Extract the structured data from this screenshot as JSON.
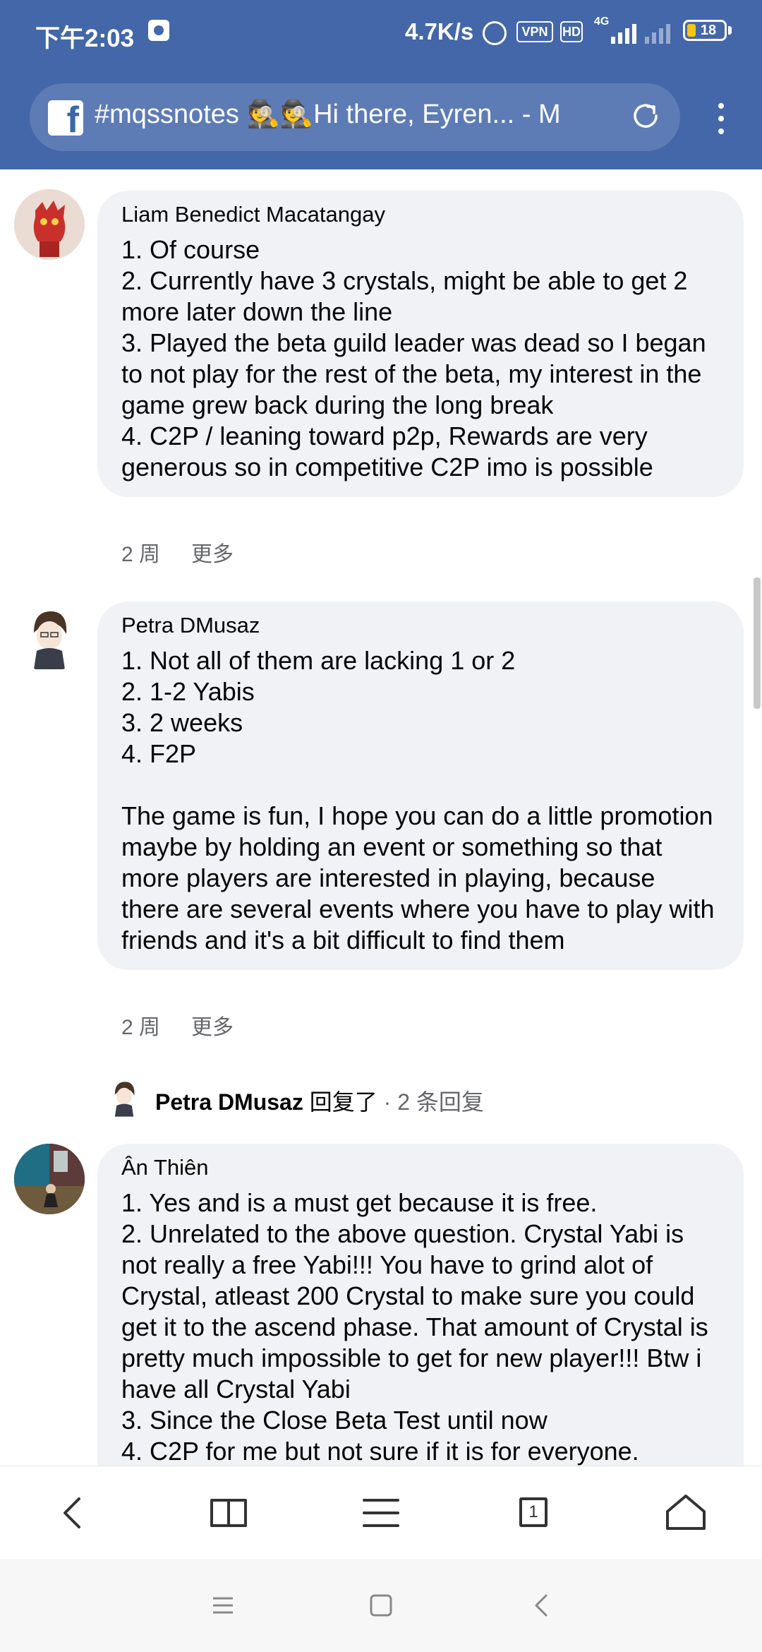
{
  "status_bar": {
    "time": "下午2:03",
    "net_speed": "4.7K/s",
    "vpn_label": "VPN",
    "hd_label": "HD",
    "network_label": "4G",
    "battery_level": "18"
  },
  "browser": {
    "tab_title": "#mqssnotes 🕵️🕵️Hi there, Eyren... - M",
    "favicon": "facebook-icon",
    "reload_icon": "reload-icon",
    "menu_icon": "more-vertical-icon"
  },
  "comments": [
    {
      "author": "Liam Benedict Macatangay",
      "text": "1. Of course\n2. Currently have 3 crystals, might be able to get 2 more later down the line\n3. Played the beta guild leader was dead so I began to not play for the rest of the beta, my interest in the game grew back during the long break\n4. C2P / leaning toward p2p, Rewards are very generous so in competitive C2P imo is possible",
      "time": "2 周",
      "more": "更多"
    },
    {
      "author": "Petra DMusaz",
      "text": "1. Not all of them are lacking 1 or 2\n2. 1-2 Yabis\n3. 2 weeks\n4. F2P\n\nThe game is fun, I hope you can do a little promotion maybe by holding an event or something so that more players are interested in playing, because there are several events where you have to play with friends and it's a bit difficult to find them",
      "time": "2 周",
      "more": "更多"
    },
    {
      "author": "Ân Thiên",
      "text": "1. Yes and is a must get because it is free.\n2. Unrelated to the above question. Crystal Yabi is not really a free Yabi!!! You have to grind alot of Crystal, atleast 200 Crystal to make sure you could get it to the ascend phase. That amount of Crystal is pretty much impossible to get for new player!!! Btw i have all Crystal Yabi\n3. Since the Close Beta Test until now\n4. C2P for me but not sure if it is for everyone."
    }
  ],
  "reply_summary": {
    "author": "Petra DMusaz",
    "verb": "回复了",
    "count": "· 2 条回复"
  },
  "toolbar": {
    "back_icon": "back-icon",
    "bookmarks_icon": "book-icon",
    "menu_icon": "menu-icon",
    "tabs_count": "1",
    "home_icon": "home-icon"
  },
  "system_nav": {
    "recents_icon": "recents-icon",
    "home_icon": "square-home-icon",
    "back_icon": "system-back-icon"
  },
  "colors": {
    "header_blue": "#4367a8",
    "url_pill": "#5d7cb6",
    "bubble_bg": "#f0f2f5",
    "meta_text": "#65676b"
  }
}
